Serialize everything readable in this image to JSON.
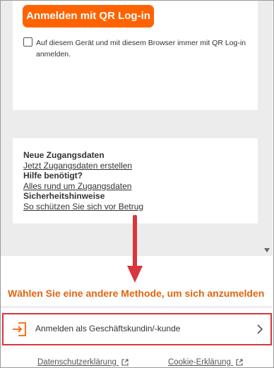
{
  "qr_login": {
    "button_label": "Anmelden mit QR Log-in",
    "remember_label": "Auf diesem Gerät und mit diesem Browser immer mit QR Log-in anmelden."
  },
  "info": {
    "new_credentials_title": "Neue Zugangsdaten",
    "new_credentials_link": "Jetzt Zugangsdaten erstellen",
    "help_title": "Hilfe benötigt?",
    "help_link": "Alles rund um Zugangsdaten",
    "security_title": "Sicherheitshinweise",
    "security_link": "So schützen Sie sich vor Betrug"
  },
  "other_methods": {
    "heading": "Wählen Sie eine andere Methode, um sich anzumelden",
    "business_login_label": "Anmelden als Geschäftskundin/-kunde"
  },
  "footer": {
    "privacy_label": "Datenschutzerklärung",
    "cookie_label": "Cookie-Erklärung"
  },
  "colors": {
    "brand_orange": "#ff6200",
    "heading_orange": "#e0650f",
    "annotation_red": "#d9363e"
  }
}
